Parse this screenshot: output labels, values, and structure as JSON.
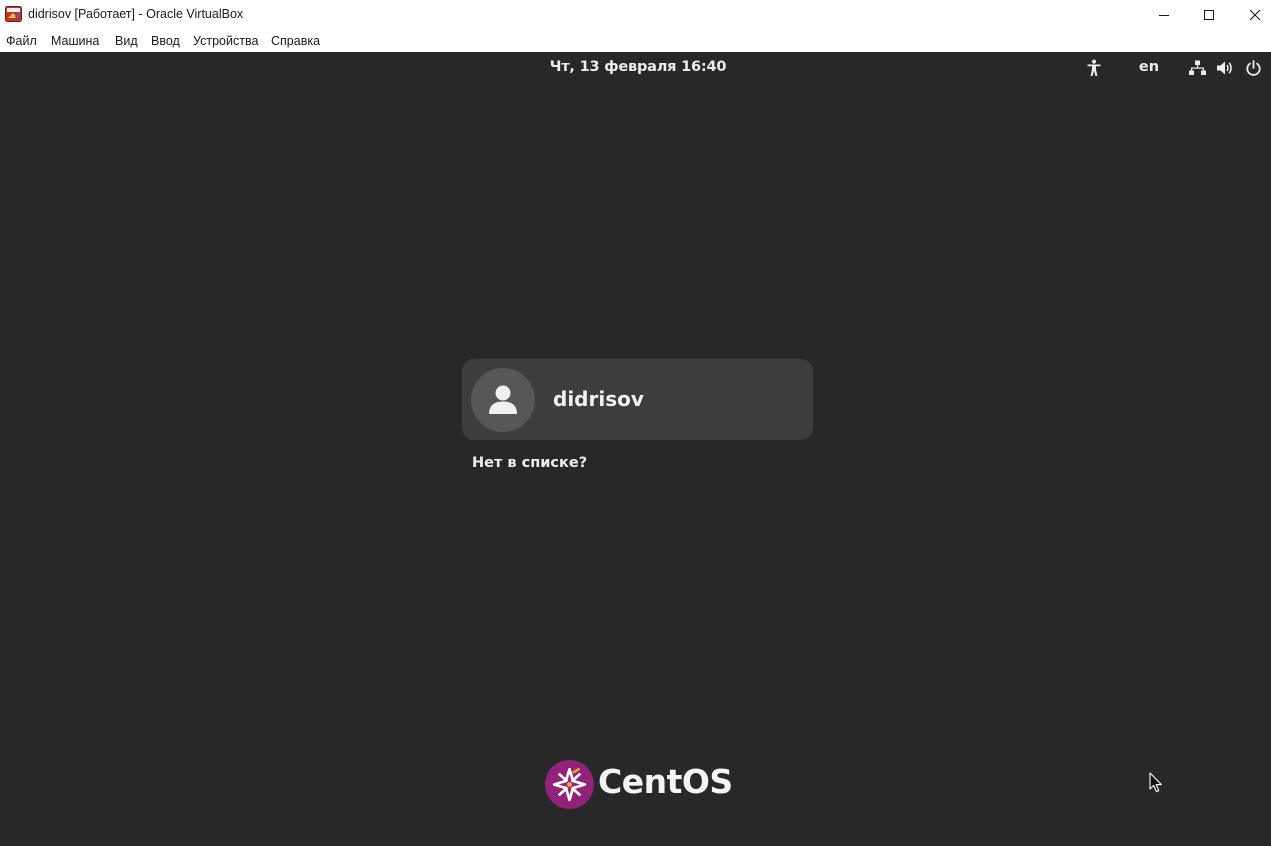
{
  "window": {
    "title": "didrisov [Работает] - Oracle VirtualBox",
    "app_icon": "virtualbox-icon",
    "controls": [
      "minimize-icon",
      "maximize-icon",
      "close-icon"
    ]
  },
  "menubar": {
    "items": [
      "Файл",
      "Машина",
      "Вид",
      "Ввод",
      "Устройства",
      "Справка"
    ]
  },
  "guest": {
    "top_bar": {
      "clock": "Чт, 13 февраля  16:40",
      "language": "en",
      "icons": [
        "accessibility-icon",
        "network-icon",
        "volume-icon",
        "power-icon"
      ]
    },
    "login": {
      "user_name": "didrisov",
      "avatar_icon": "user-avatar-icon",
      "not_listed": "Нет в списке?"
    },
    "branding": {
      "name": "CentOS",
      "logo_icon": "centos-logo-icon"
    }
  },
  "colors": {
    "screen_bg": "#282828",
    "card_bg": "#3d3d3d",
    "avatar_bg": "#575757",
    "text": "#ececec",
    "centos_purple": "#932279",
    "centos_yellow": "#efa724"
  }
}
